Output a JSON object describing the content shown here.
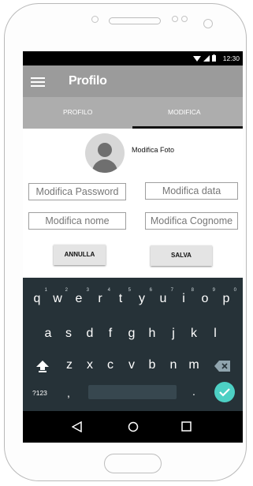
{
  "status_bar": {
    "time": "12:30",
    "icons": [
      "wifi-icon",
      "signal-icon",
      "battery-icon"
    ]
  },
  "app_bar": {
    "title": "Profilo",
    "menu_icon": "hamburger-menu-icon"
  },
  "tabs": [
    {
      "label": "PROFILO",
      "selected": false
    },
    {
      "label": "MODIFICA",
      "selected": true
    }
  ],
  "profile": {
    "photo_label": "Modifica Foto",
    "avatar_icon": "person-avatar-icon"
  },
  "fields": {
    "password": "Modifica Password",
    "date": "Modifica data",
    "name": "Modifica nome",
    "surname": "Modifica Cognome"
  },
  "buttons": {
    "cancel": "ANNULLA",
    "save": "SALVA"
  },
  "keyboard": {
    "row1": [
      "q",
      "w",
      "e",
      "r",
      "t",
      "y",
      "u",
      "i",
      "o",
      "p"
    ],
    "row1_hints": [
      "1",
      "2",
      "3",
      "4",
      "5",
      "6",
      "7",
      "8",
      "9",
      "0"
    ],
    "row2": [
      "a",
      "s",
      "d",
      "f",
      "g",
      "h",
      "j",
      "k",
      "l"
    ],
    "row3": [
      "z",
      "x",
      "c",
      "v",
      "b",
      "n",
      "m"
    ],
    "symbols_label": "?123",
    "comma": ",",
    "period": ".",
    "shift_icon": "shift-arrow-icon",
    "backspace_icon": "backspace-icon",
    "enter_icon": "checkmark-icon",
    "enter_color": "#4dd0c4"
  },
  "nav_bar": {
    "icons": [
      "back-triangle-icon",
      "home-circle-icon",
      "recents-square-icon"
    ]
  },
  "colors": {
    "app_bar": "#9b9b9b",
    "tabs": "#adadad",
    "keyboard": "#263238"
  }
}
